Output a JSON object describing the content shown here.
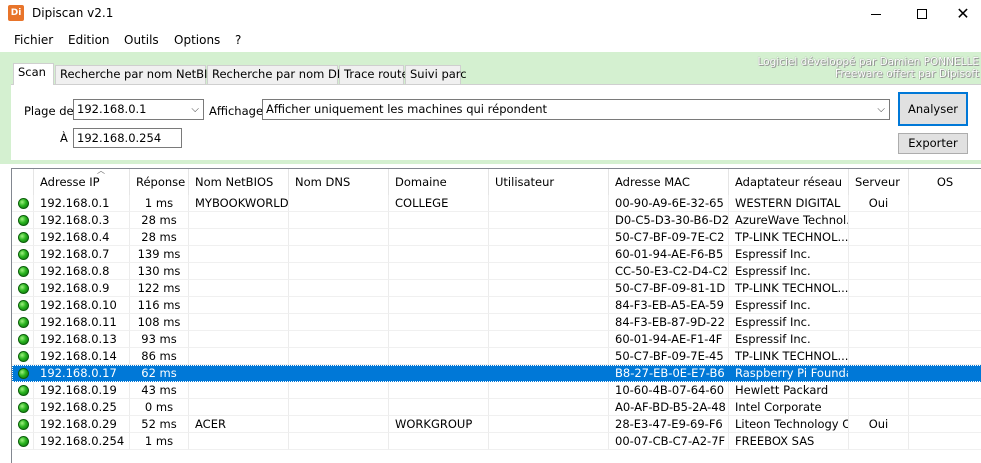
{
  "window": {
    "title": "Dipiscan v2.1",
    "icon_text": "Di"
  },
  "menu": [
    "Fichier",
    "Edition",
    "Outils",
    "Options",
    "?"
  ],
  "credits": {
    "line1": "Logiciel développé par Damien PONNELLE",
    "line2": "Freeware offert par Dipisoft"
  },
  "tabs": [
    "Scan",
    "Recherche par nom NetBIOS",
    "Recherche par nom DNS",
    "Trace route",
    "Suivi parc"
  ],
  "form": {
    "range_label": "Plage de",
    "from_value": "192.168.0.1",
    "to_label": "À",
    "to_value": "192.168.0.254",
    "display_label": "Affichage",
    "display_value": "Afficher uniquement les machines qui répondent",
    "analyze_button": "Analyser",
    "export_button": "Exporter"
  },
  "columns": [
    "Adresse IP",
    "Réponse",
    "Nom NetBIOS",
    "Nom DNS",
    "Domaine",
    "Utilisateur",
    "Adresse MAC",
    "Adaptateur réseau",
    "Serveur",
    "OS"
  ],
  "rows": [
    {
      "ip": "192.168.0.1",
      "resp": "1 ms",
      "netbios": "MYBOOKWORLD",
      "dns": "",
      "domain": "COLLEGE",
      "user": "",
      "mac": "00-90-A9-6E-32-65",
      "adapter": "WESTERN DIGITAL",
      "server": "Oui",
      "os": "",
      "status": "green"
    },
    {
      "ip": "192.168.0.3",
      "resp": "28 ms",
      "netbios": "",
      "dns": "",
      "domain": "",
      "user": "",
      "mac": "D0-C5-D3-30-B6-D2",
      "adapter": "AzureWave Technol...",
      "server": "",
      "os": "",
      "status": "green"
    },
    {
      "ip": "192.168.0.4",
      "resp": "28 ms",
      "netbios": "",
      "dns": "",
      "domain": "",
      "user": "",
      "mac": "50-C7-BF-09-7E-C2",
      "adapter": "TP-LINK TECHNOL...",
      "server": "",
      "os": "",
      "status": "green"
    },
    {
      "ip": "192.168.0.7",
      "resp": "139 ms",
      "netbios": "",
      "dns": "",
      "domain": "",
      "user": "",
      "mac": "60-01-94-AE-F6-B5",
      "adapter": "Espressif Inc.",
      "server": "",
      "os": "",
      "status": "green"
    },
    {
      "ip": "192.168.0.8",
      "resp": "130 ms",
      "netbios": "",
      "dns": "",
      "domain": "",
      "user": "",
      "mac": "CC-50-E3-C2-D4-C2",
      "adapter": "Espressif Inc.",
      "server": "",
      "os": "",
      "status": "green"
    },
    {
      "ip": "192.168.0.9",
      "resp": "122 ms",
      "netbios": "",
      "dns": "",
      "domain": "",
      "user": "",
      "mac": "50-C7-BF-09-81-1D",
      "adapter": "TP-LINK TECHNOL...",
      "server": "",
      "os": "",
      "status": "green"
    },
    {
      "ip": "192.168.0.10",
      "resp": "116 ms",
      "netbios": "",
      "dns": "",
      "domain": "",
      "user": "",
      "mac": "84-F3-EB-A5-EA-59",
      "adapter": "Espressif Inc.",
      "server": "",
      "os": "",
      "status": "green"
    },
    {
      "ip": "192.168.0.11",
      "resp": "108 ms",
      "netbios": "",
      "dns": "",
      "domain": "",
      "user": "",
      "mac": "84-F3-EB-87-9D-22",
      "adapter": "Espressif Inc.",
      "server": "",
      "os": "",
      "status": "green"
    },
    {
      "ip": "192.168.0.13",
      "resp": "93 ms",
      "netbios": "",
      "dns": "",
      "domain": "",
      "user": "",
      "mac": "60-01-94-AE-F1-4F",
      "adapter": "Espressif Inc.",
      "server": "",
      "os": "",
      "status": "green"
    },
    {
      "ip": "192.168.0.14",
      "resp": "86 ms",
      "netbios": "",
      "dns": "",
      "domain": "",
      "user": "",
      "mac": "50-C7-BF-09-7E-45",
      "adapter": "TP-LINK TECHNOL...",
      "server": "",
      "os": "",
      "status": "green"
    },
    {
      "ip": "192.168.0.17",
      "resp": "62 ms",
      "netbios": "",
      "dns": "",
      "domain": "",
      "user": "",
      "mac": "B8-27-EB-0E-E7-B6",
      "adapter": "Raspberry Pi Founda...",
      "server": "",
      "os": "",
      "status": "green",
      "selected": true
    },
    {
      "ip": "192.168.0.19",
      "resp": "43 ms",
      "netbios": "",
      "dns": "",
      "domain": "",
      "user": "",
      "mac": "10-60-4B-07-64-60",
      "adapter": "Hewlett Packard",
      "server": "",
      "os": "",
      "status": "green"
    },
    {
      "ip": "192.168.0.25",
      "resp": "0 ms",
      "netbios": "",
      "dns": "",
      "domain": "",
      "user": "",
      "mac": "A0-AF-BD-B5-2A-48",
      "adapter": "Intel Corporate",
      "server": "",
      "os": "",
      "status": "green"
    },
    {
      "ip": "192.168.0.29",
      "resp": "52 ms",
      "netbios": "ACER",
      "dns": "",
      "domain": "WORKGROUP",
      "user": "",
      "mac": "28-E3-47-E9-69-F6",
      "adapter": "Liteon Technology C...",
      "server": "Oui",
      "os": "",
      "status": "green"
    },
    {
      "ip": "192.168.0.254",
      "resp": "1 ms",
      "netbios": "",
      "dns": "",
      "domain": "",
      "user": "",
      "mac": "00-07-CB-C7-A2-7F",
      "adapter": "FREEBOX SAS",
      "server": "",
      "os": "",
      "status": "green"
    }
  ],
  "colors": {
    "panel_bg": "#d4f0d0",
    "selection": "#0078d7",
    "status_green": "#29b41f"
  }
}
